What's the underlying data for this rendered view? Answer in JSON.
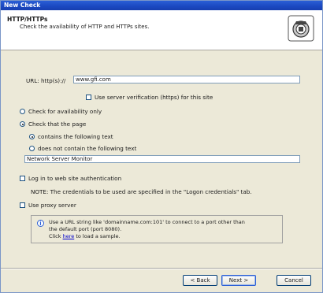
{
  "window": {
    "title": "New Check"
  },
  "header": {
    "title": "HTTP/HTTPs",
    "subtitle": "Check the availability of HTTP and HTTPs sites.",
    "icon": "network-check-icon"
  },
  "form": {
    "url_label": "URL: http(s)://",
    "url_value": "www.gfi.com",
    "use_server_verification_label": "Use server verification (https) for this site",
    "check_availability_label": "Check for availability only",
    "check_page_label": "Check that the page",
    "contains_label": "contains the following text",
    "not_contains_label": "does not contain the following text",
    "text_value": "Network Server Monitor",
    "login_auth_label": "Log in to web site authentication",
    "note_text": "NOTE: The credentials to be used are specified in the \"Logon credentials\" tab.",
    "use_proxy_label": "Use proxy server"
  },
  "info": {
    "line1": "Use a URL string like 'domainname.com:101' to connect to a port other than",
    "line2": "the default port (port 8080).",
    "line3_prefix": "Click",
    "line3_link": "here",
    "line3_suffix": "to load a sample."
  },
  "buttons": {
    "back": "< Back",
    "next": "Next >",
    "cancel": "Cancel"
  }
}
